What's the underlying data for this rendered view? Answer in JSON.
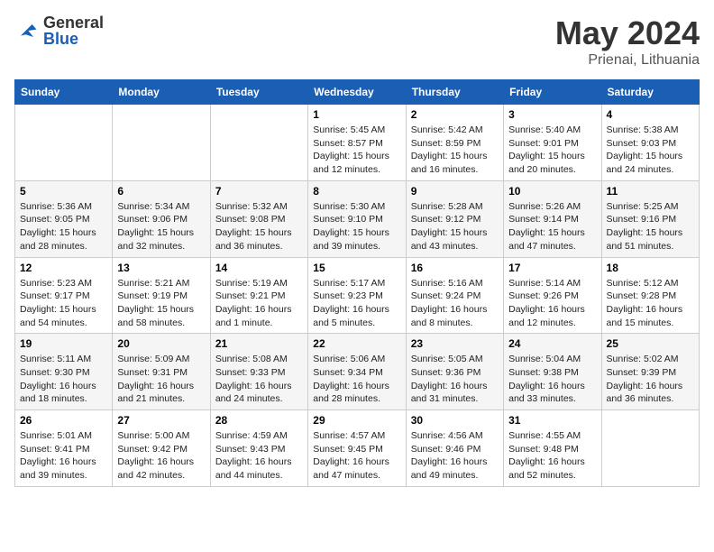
{
  "header": {
    "logo_general": "General",
    "logo_blue": "Blue",
    "title": "May 2024",
    "location": "Prienai, Lithuania"
  },
  "days_of_week": [
    "Sunday",
    "Monday",
    "Tuesday",
    "Wednesday",
    "Thursday",
    "Friday",
    "Saturday"
  ],
  "weeks": [
    [
      {
        "day": "",
        "info": ""
      },
      {
        "day": "",
        "info": ""
      },
      {
        "day": "",
        "info": ""
      },
      {
        "day": "1",
        "info": "Sunrise: 5:45 AM\nSunset: 8:57 PM\nDaylight: 15 hours\nand 12 minutes."
      },
      {
        "day": "2",
        "info": "Sunrise: 5:42 AM\nSunset: 8:59 PM\nDaylight: 15 hours\nand 16 minutes."
      },
      {
        "day": "3",
        "info": "Sunrise: 5:40 AM\nSunset: 9:01 PM\nDaylight: 15 hours\nand 20 minutes."
      },
      {
        "day": "4",
        "info": "Sunrise: 5:38 AM\nSunset: 9:03 PM\nDaylight: 15 hours\nand 24 minutes."
      }
    ],
    [
      {
        "day": "5",
        "info": "Sunrise: 5:36 AM\nSunset: 9:05 PM\nDaylight: 15 hours\nand 28 minutes."
      },
      {
        "day": "6",
        "info": "Sunrise: 5:34 AM\nSunset: 9:06 PM\nDaylight: 15 hours\nand 32 minutes."
      },
      {
        "day": "7",
        "info": "Sunrise: 5:32 AM\nSunset: 9:08 PM\nDaylight: 15 hours\nand 36 minutes."
      },
      {
        "day": "8",
        "info": "Sunrise: 5:30 AM\nSunset: 9:10 PM\nDaylight: 15 hours\nand 39 minutes."
      },
      {
        "day": "9",
        "info": "Sunrise: 5:28 AM\nSunset: 9:12 PM\nDaylight: 15 hours\nand 43 minutes."
      },
      {
        "day": "10",
        "info": "Sunrise: 5:26 AM\nSunset: 9:14 PM\nDaylight: 15 hours\nand 47 minutes."
      },
      {
        "day": "11",
        "info": "Sunrise: 5:25 AM\nSunset: 9:16 PM\nDaylight: 15 hours\nand 51 minutes."
      }
    ],
    [
      {
        "day": "12",
        "info": "Sunrise: 5:23 AM\nSunset: 9:17 PM\nDaylight: 15 hours\nand 54 minutes."
      },
      {
        "day": "13",
        "info": "Sunrise: 5:21 AM\nSunset: 9:19 PM\nDaylight: 15 hours\nand 58 minutes."
      },
      {
        "day": "14",
        "info": "Sunrise: 5:19 AM\nSunset: 9:21 PM\nDaylight: 16 hours\nand 1 minute."
      },
      {
        "day": "15",
        "info": "Sunrise: 5:17 AM\nSunset: 9:23 PM\nDaylight: 16 hours\nand 5 minutes."
      },
      {
        "day": "16",
        "info": "Sunrise: 5:16 AM\nSunset: 9:24 PM\nDaylight: 16 hours\nand 8 minutes."
      },
      {
        "day": "17",
        "info": "Sunrise: 5:14 AM\nSunset: 9:26 PM\nDaylight: 16 hours\nand 12 minutes."
      },
      {
        "day": "18",
        "info": "Sunrise: 5:12 AM\nSunset: 9:28 PM\nDaylight: 16 hours\nand 15 minutes."
      }
    ],
    [
      {
        "day": "19",
        "info": "Sunrise: 5:11 AM\nSunset: 9:30 PM\nDaylight: 16 hours\nand 18 minutes."
      },
      {
        "day": "20",
        "info": "Sunrise: 5:09 AM\nSunset: 9:31 PM\nDaylight: 16 hours\nand 21 minutes."
      },
      {
        "day": "21",
        "info": "Sunrise: 5:08 AM\nSunset: 9:33 PM\nDaylight: 16 hours\nand 24 minutes."
      },
      {
        "day": "22",
        "info": "Sunrise: 5:06 AM\nSunset: 9:34 PM\nDaylight: 16 hours\nand 28 minutes."
      },
      {
        "day": "23",
        "info": "Sunrise: 5:05 AM\nSunset: 9:36 PM\nDaylight: 16 hours\nand 31 minutes."
      },
      {
        "day": "24",
        "info": "Sunrise: 5:04 AM\nSunset: 9:38 PM\nDaylight: 16 hours\nand 33 minutes."
      },
      {
        "day": "25",
        "info": "Sunrise: 5:02 AM\nSunset: 9:39 PM\nDaylight: 16 hours\nand 36 minutes."
      }
    ],
    [
      {
        "day": "26",
        "info": "Sunrise: 5:01 AM\nSunset: 9:41 PM\nDaylight: 16 hours\nand 39 minutes."
      },
      {
        "day": "27",
        "info": "Sunrise: 5:00 AM\nSunset: 9:42 PM\nDaylight: 16 hours\nand 42 minutes."
      },
      {
        "day": "28",
        "info": "Sunrise: 4:59 AM\nSunset: 9:43 PM\nDaylight: 16 hours\nand 44 minutes."
      },
      {
        "day": "29",
        "info": "Sunrise: 4:57 AM\nSunset: 9:45 PM\nDaylight: 16 hours\nand 47 minutes."
      },
      {
        "day": "30",
        "info": "Sunrise: 4:56 AM\nSunset: 9:46 PM\nDaylight: 16 hours\nand 49 minutes."
      },
      {
        "day": "31",
        "info": "Sunrise: 4:55 AM\nSunset: 9:48 PM\nDaylight: 16 hours\nand 52 minutes."
      },
      {
        "day": "",
        "info": ""
      }
    ]
  ]
}
